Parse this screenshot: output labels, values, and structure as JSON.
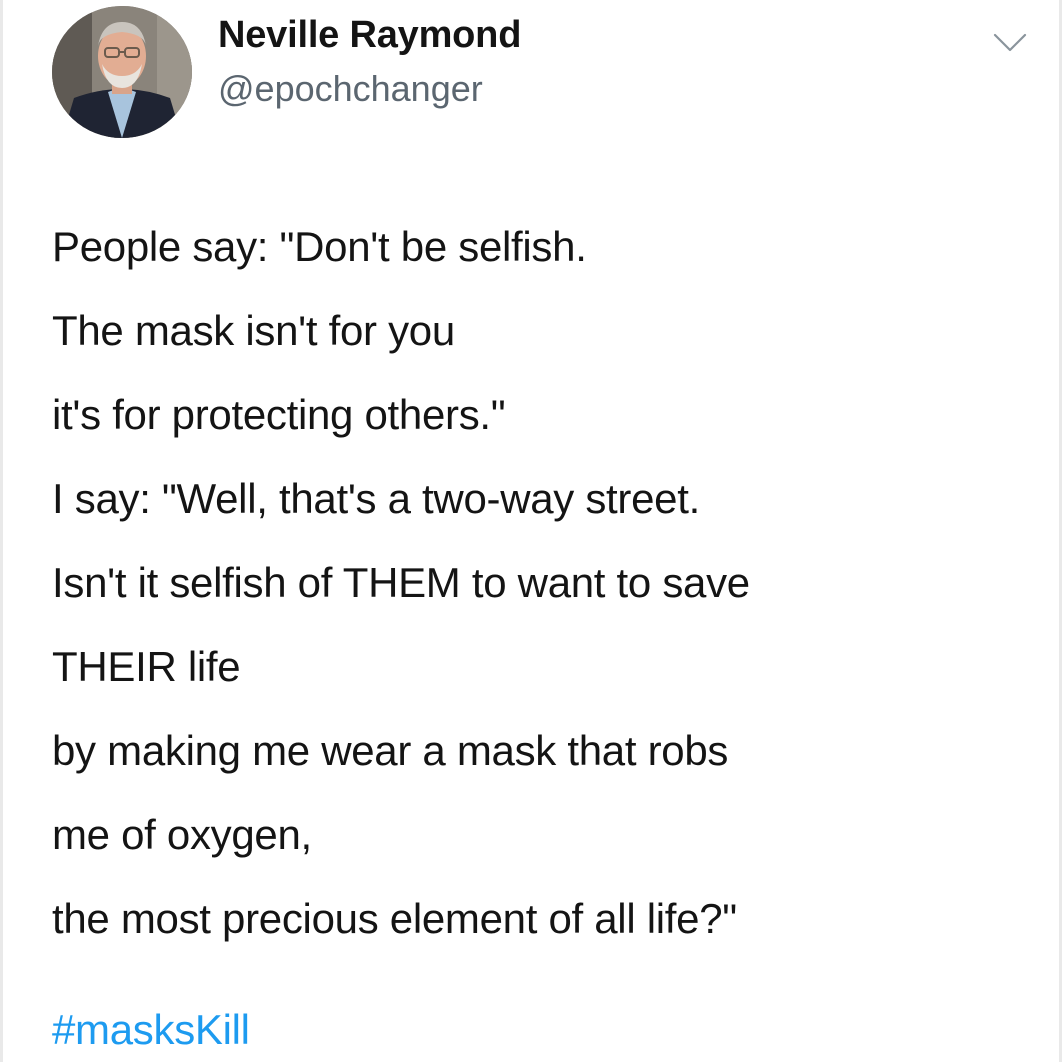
{
  "author": {
    "display_name": "Neville Raymond",
    "handle": "@epochchanger"
  },
  "icons": {
    "avatar": "profile-photo",
    "menu": "chevron-down-icon"
  },
  "tweet": {
    "paragraphs": [
      [
        "People say: \"Don't be selfish.",
        "The mask isn't for you",
        "it's for protecting others.\""
      ],
      [
        "I say: \"Well, that's a two-way street.",
        "Isn't it selfish of THEM to want to save",
        "THEIR life",
        "by making me wear a mask that robs",
        "me of oxygen,",
        "the most precious element of all life?\""
      ]
    ],
    "hashtag": "#masksKill"
  },
  "colors": {
    "text": "#141414",
    "secondary": "#5b6670",
    "link": "#1d9bf0"
  }
}
